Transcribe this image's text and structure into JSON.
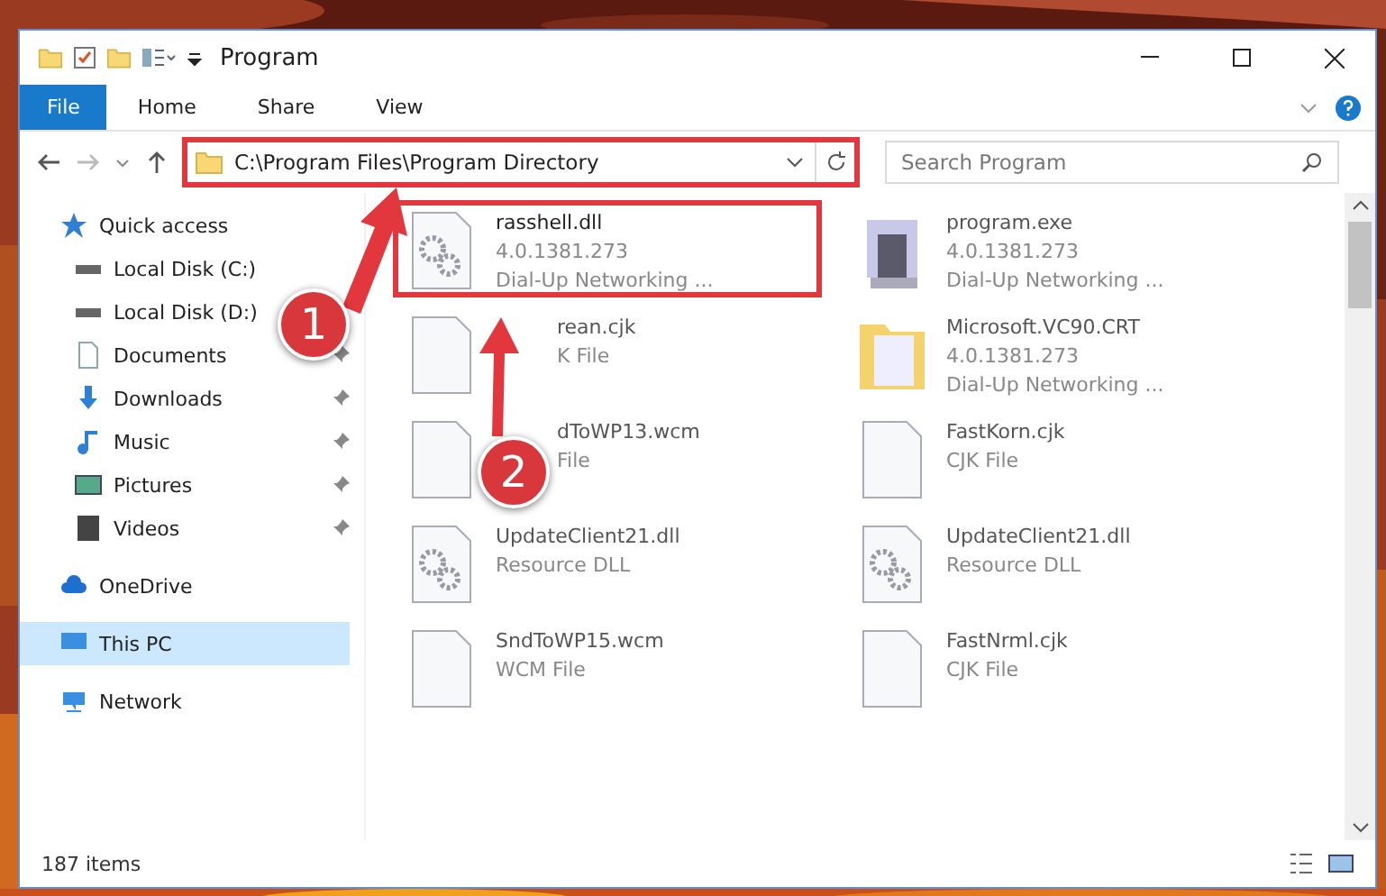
{
  "window": {
    "title": "Program"
  },
  "ribbon_tabs": [
    {
      "label": "File",
      "kind": "file"
    },
    {
      "label": "Home",
      "kind": "tab"
    },
    {
      "label": "Share",
      "kind": "tab"
    },
    {
      "label": "View",
      "kind": "tab"
    }
  ],
  "address": {
    "path": "C:\\Program Files\\Program Directory"
  },
  "search": {
    "placeholder": "Search Program"
  },
  "sidebar": {
    "items": [
      {
        "label": "Quick access",
        "kind": "star",
        "selected": false,
        "pinned": false,
        "children": [
          {
            "label": "Local Disk (C:)",
            "kind": "drive",
            "selected": false,
            "pinned": false
          },
          {
            "label": "Local Disk (D:)",
            "kind": "drive",
            "selected": false,
            "pinned": false
          },
          {
            "label": "Documents",
            "kind": "document",
            "selected": false,
            "pinned": true
          },
          {
            "label": "Downloads",
            "kind": "download",
            "selected": false,
            "pinned": true
          },
          {
            "label": "Music",
            "kind": "music",
            "selected": false,
            "pinned": true
          },
          {
            "label": "Pictures",
            "kind": "pictures",
            "selected": false,
            "pinned": true
          },
          {
            "label": "Videos",
            "kind": "video",
            "selected": false,
            "pinned": true
          }
        ]
      },
      {
        "label": "OneDrive",
        "kind": "cloud",
        "selected": false,
        "pinned": false
      },
      {
        "label": "This PC",
        "kind": "computer",
        "selected": true,
        "pinned": false
      },
      {
        "label": "Network",
        "kind": "network",
        "selected": false,
        "pinned": false
      }
    ]
  },
  "files": [
    {
      "name": "rasshell.dll",
      "details": [
        "4.0.1381.273",
        "Dial-Up Networking ..."
      ],
      "kind": "gears",
      "highlighted": true
    },
    {
      "name": "program.exe",
      "details": [
        "4.0.1381.273",
        "Dial-Up Networking ..."
      ],
      "kind": "program",
      "highlighted": false
    },
    {
      "name": "rean.cjk",
      "details": [
        "K File"
      ],
      "kind": "blank",
      "highlighted": false
    },
    {
      "name": "Microsoft.VC90.CRT",
      "details": [
        "4.0.1381.273",
        "Dial-Up Networking ..."
      ],
      "kind": "folder",
      "highlighted": false
    },
    {
      "name": "dToWP13.wcm",
      "details": [
        "File"
      ],
      "kind": "blank",
      "highlighted": false
    },
    {
      "name": "FastKorn.cjk",
      "details": [
        "CJK File"
      ],
      "kind": "blank",
      "highlighted": false
    },
    {
      "name": "UpdateClient21.dll",
      "details": [
        "Resource DLL"
      ],
      "kind": "gears",
      "highlighted": false
    },
    {
      "name": "UpdateClient21.dll",
      "details": [
        "Resource DLL"
      ],
      "kind": "gears",
      "highlighted": false
    },
    {
      "name": "SndToWP15.wcm",
      "details": [
        "WCM File"
      ],
      "kind": "blank",
      "highlighted": false
    },
    {
      "name": "FastNrml.cjk",
      "details": [
        "CJK File"
      ],
      "kind": "blank",
      "highlighted": false
    }
  ],
  "status_bar": {
    "count": "187 items"
  },
  "annotations": [
    {
      "label": "1"
    },
    {
      "label": "2"
    }
  ]
}
